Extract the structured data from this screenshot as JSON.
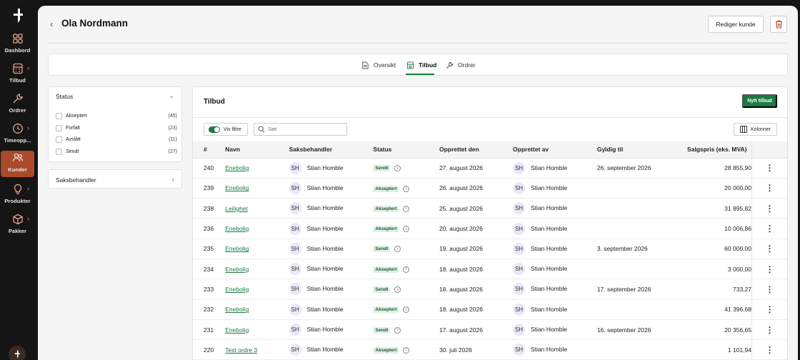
{
  "sidebar": {
    "items": [
      {
        "label": "Dashbord",
        "icon": "dashboard-icon",
        "chevron": false
      },
      {
        "label": "Tilbud",
        "icon": "calculator-icon",
        "chevron": true
      },
      {
        "label": "Ordrer",
        "icon": "wrench-icon",
        "chevron": false
      },
      {
        "label": "Timeopp...",
        "icon": "clock-icon",
        "chevron": true
      },
      {
        "label": "Kunder",
        "icon": "users-icon",
        "chevron": false,
        "active": true
      },
      {
        "label": "Produkter",
        "icon": "lightbulb-icon",
        "chevron": true
      },
      {
        "label": "Pakker",
        "icon": "package-icon",
        "chevron": true
      }
    ]
  },
  "header": {
    "title": "Ola Nordmann",
    "edit_label": "Rediger kunde"
  },
  "tabs": [
    {
      "label": "Oversikt",
      "icon": "document-icon"
    },
    {
      "label": "Tilbud",
      "icon": "calculator-icon",
      "active": true
    },
    {
      "label": "Ordrer",
      "icon": "wrench-icon"
    }
  ],
  "filters": {
    "status_title": "Status",
    "options": [
      {
        "label": "Akseptert",
        "count": "(45)"
      },
      {
        "label": "Forfalt",
        "count": "(23)"
      },
      {
        "label": "Avslått",
        "count": "(11)"
      },
      {
        "label": "Sendt",
        "count": "(27)"
      }
    ],
    "saksbehandler_title": "Saksbehandler"
  },
  "table_panel": {
    "title": "Tilbud",
    "new_button": "Nytt tilbud",
    "toggle_label": "Vis filtre",
    "search_placeholder": "Søk",
    "columns_button": "Kolonner",
    "columns": [
      "#",
      "Navn",
      "Saksbehandler",
      "Status",
      "Opprettet den",
      "Opprettet av",
      "Gyldig til",
      "Salgspris (eks. MVA)"
    ],
    "rows": [
      {
        "id": "240",
        "name": "Enebolig",
        "handler_initials": "SH",
        "handler": "Stian Homble",
        "status": "Sendt",
        "created": "27. august 2026",
        "creator_initials": "SH",
        "creator": "Stian Homble",
        "valid": "26. september 2026",
        "price": "28 855,90"
      },
      {
        "id": "239",
        "name": "Enebolig",
        "handler_initials": "SH",
        "handler": "Stian Homble",
        "status": "Akseptert",
        "created": "26. august 2026",
        "creator_initials": "SH",
        "creator": "Stian Homble",
        "valid": "",
        "price": "20 000,00"
      },
      {
        "id": "238",
        "name": "Leilighet",
        "handler_initials": "SH",
        "handler": "Stian Homble",
        "status": "Akseptert",
        "created": "25. august 2026",
        "creator_initials": "SH",
        "creator": "Stian Homble",
        "valid": "",
        "price": "31 895,82"
      },
      {
        "id": "236",
        "name": "Enebolig",
        "handler_initials": "SH",
        "handler": "Stian Homble",
        "status": "Akseptert",
        "created": "20. august 2026",
        "creator_initials": "SH",
        "creator": "Stian Homble",
        "valid": "",
        "price": "10 006,86"
      },
      {
        "id": "235",
        "name": "Enebolig",
        "handler_initials": "SH",
        "handler": "Stian Homble",
        "status": "Sendt",
        "created": "19. august 2026",
        "creator_initials": "SH",
        "creator": "Stian Homble",
        "valid": "3. september 2026",
        "price": "60 000,00"
      },
      {
        "id": "234",
        "name": "Enebolig",
        "handler_initials": "SH",
        "handler": "Stian Homble",
        "status": "Akseptert",
        "created": "18. august 2026",
        "creator_initials": "SH",
        "creator": "Stian Homble",
        "valid": "",
        "price": "3 000,00"
      },
      {
        "id": "233",
        "name": "Enebolig",
        "handler_initials": "SH",
        "handler": "Stian Homble",
        "status": "Sendt",
        "created": "18. august 2026",
        "creator_initials": "SH",
        "creator": "Stian Homble",
        "valid": "17. september 2026",
        "price": "733,27"
      },
      {
        "id": "232",
        "name": "Enebolig",
        "handler_initials": "SH",
        "handler": "Stian Homble",
        "status": "Akseptert",
        "created": "18. august 2026",
        "creator_initials": "SH",
        "creator": "Stian Homble",
        "valid": "",
        "price": "41 396,68"
      },
      {
        "id": "231",
        "name": "Enebolig",
        "handler_initials": "SH",
        "handler": "Stian Homble",
        "status": "Sendt",
        "created": "17. august 2026",
        "creator_initials": "SH",
        "creator": "Stian Homble",
        "valid": "16. september 2026",
        "price": "20 356,65"
      },
      {
        "id": "220",
        "name": "Test ordre 3",
        "handler_initials": "SH",
        "handler": "Stian Homble",
        "status": "Akseptert",
        "created": "30. juli 2026",
        "creator_initials": "SH",
        "creator": "Stian Homble",
        "valid": "",
        "price": "1 101,94"
      }
    ]
  },
  "colors": {
    "accent_green": "#1c7a42",
    "active_nav": "#a84a2b",
    "sidebar_bg": "#151515"
  }
}
